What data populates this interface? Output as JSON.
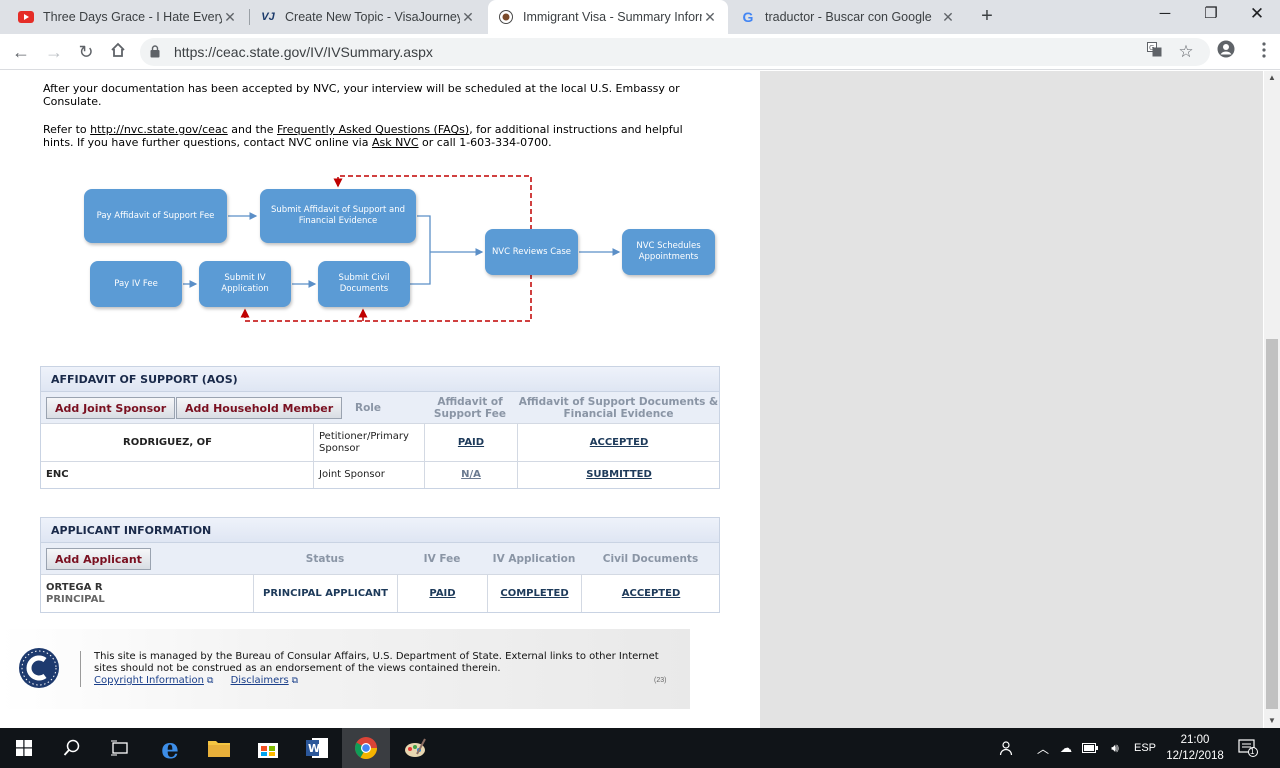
{
  "browser": {
    "tabs": [
      {
        "title": "Three Days Grace - I Hate Everyth",
        "icon": "youtube-icon"
      },
      {
        "title": "Create New Topic - VisaJourney",
        "icon": "visajourney-icon"
      },
      {
        "title": "Immigrant Visa - Summary Inform",
        "icon": "state-seal-icon",
        "active": true
      },
      {
        "title": "traductor - Buscar con Google",
        "icon": "google-icon"
      }
    ],
    "url": "https://ceac.state.gov/IV/IVSummary.aspx"
  },
  "intro": {
    "para1": "After your documentation has been accepted by NVC, your interview will be scheduled at the local U.S. Embassy or Consulate.",
    "para2_prefix": "Refer to ",
    "nvc_link": "http://nvc.state.gov/ceac",
    "para2_mid": " and the ",
    "faq_link": "Frequently Asked Questions (FAQs)",
    "para2_mid2": ", for additional instructions and helpful hints. If you have further questions, contact NVC online via ",
    "ask_link": "Ask NVC",
    "para2_suffix": " or call 1-603-334-0700."
  },
  "flow": {
    "pay_aos": "Pay Affidavit of Support Fee",
    "submit_aos": "Submit Affidavit of Support and Financial Evidence",
    "pay_iv": "Pay IV Fee",
    "submit_iv": "Submit IV Application",
    "submit_civil": "Submit Civil Documents",
    "nvc_reviews": "NVC Reviews Case",
    "nvc_schedules": "NVC Schedules Appointments"
  },
  "aos": {
    "title": "AFFIDAVIT OF SUPPORT (AOS)",
    "add_joint": "Add Joint Sponsor",
    "add_household": "Add Household Member",
    "col_role": "Role",
    "col_fee": "Affidavit of Support Fee",
    "col_docs": "Affidavit of Support Documents & Financial Evidence",
    "rows": [
      {
        "name": "RODRIGUEZ, OF",
        "role": "Petitioner/Primary Sponsor",
        "fee": "PAID",
        "docs": "ACCEPTED"
      },
      {
        "name": "ENC",
        "role": "Joint Sponsor",
        "fee": "N/A",
        "docs": "SUBMITTED"
      }
    ]
  },
  "applicant": {
    "title": "APPLICANT INFORMATION",
    "add_applicant": "Add Applicant",
    "col_status": "Status",
    "col_ivfee": "IV Fee",
    "col_ivapp": "IV Application",
    "col_civil": "Civil Documents",
    "rows": [
      {
        "name": "ORTEGA R",
        "sub": "PRINCIPAL",
        "status": "PRINCIPAL APPLICANT",
        "ivfee": "PAID",
        "ivapp": "COMPLETED",
        "civil": "ACCEPTED"
      }
    ]
  },
  "footer": {
    "text": "This site is managed by the Bureau of Consular Affairs, U.S. Department of State. External links to other Internet sites should not be construed as an endorsement of the views contained therein.",
    "copyright": "Copyright Information",
    "disclaimers": "Disclaimers",
    "version": "(23)"
  },
  "taskbar": {
    "lang": "ESP",
    "time": "21:00",
    "date": "12/12/2018",
    "notif_count": "1"
  },
  "colors": {
    "flow_box": "#5b9bd5",
    "button_text": "#7a1020",
    "link": "#1d3a5a"
  }
}
